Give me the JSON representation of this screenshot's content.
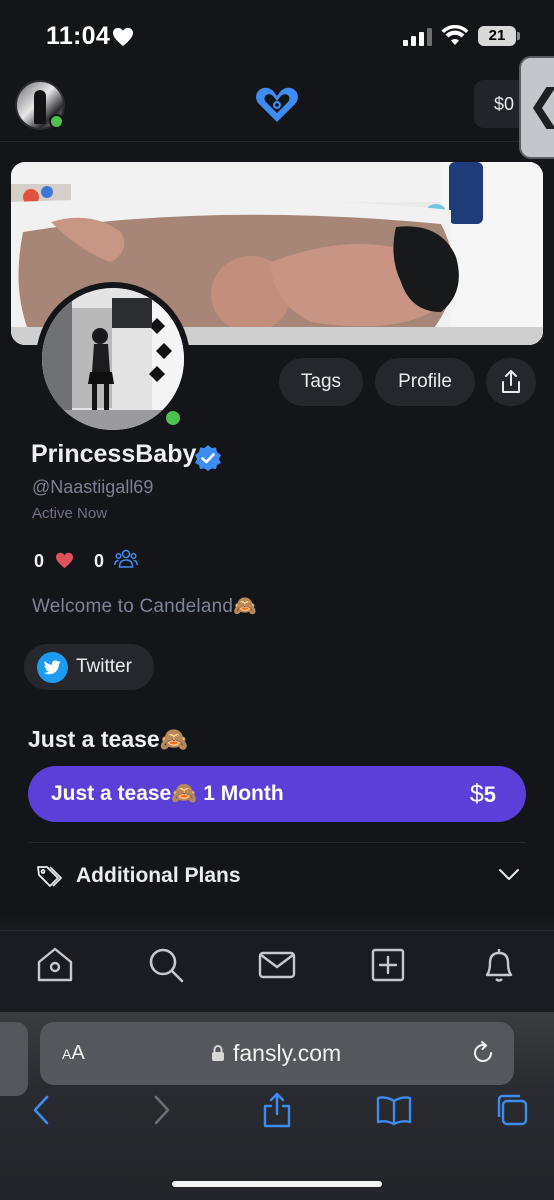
{
  "status_bar": {
    "time": "11:04",
    "battery": "21",
    "icons": [
      "heart-icon",
      "signal-icon",
      "wifi-icon",
      "battery-icon"
    ]
  },
  "header": {
    "balance": "$0",
    "logo": "fansly-logo",
    "side_tab_glyph": "❮"
  },
  "profile": {
    "display_name": "PrincessBaby",
    "username": "@Naastiigall69",
    "status": "Active Now",
    "likes_count": "0",
    "followers_count": "0",
    "bio": "Welcome to Candeland🙈",
    "actions": {
      "tags": "Tags",
      "profile": "Profile"
    },
    "social": {
      "twitter": "Twitter"
    }
  },
  "subscription": {
    "title": "Just a tease🙈",
    "plan_label": "Just a tease🙈  1 Month",
    "currency": "$",
    "price": "5",
    "additional_plans": "Additional Plans"
  },
  "bottom_nav": [
    "home-icon",
    "search-icon",
    "messages-icon",
    "create-post-icon",
    "notifications-icon"
  ],
  "browser": {
    "aa_small": "A",
    "aa_big": "A",
    "url": "fansly.com",
    "toolbar": [
      "back-icon",
      "forward-icon",
      "share-icon",
      "bookmarks-icon",
      "tabs-icon"
    ]
  },
  "colors": {
    "background": "#141519",
    "accent": "#5b3fd9",
    "brand_blue": "#3d8cf2",
    "online": "#4fbf4f",
    "muted_text": "#7b8094"
  }
}
